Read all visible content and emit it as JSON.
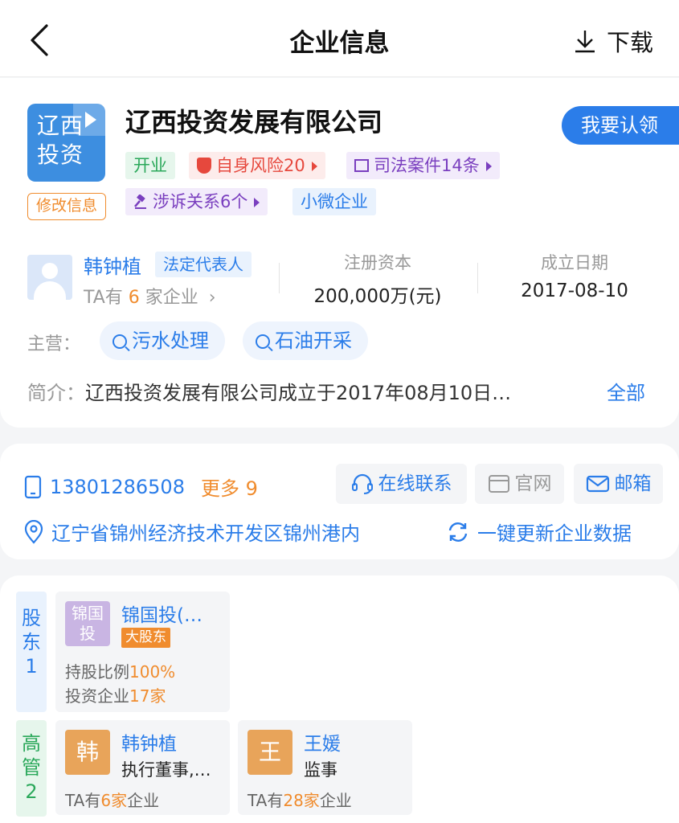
{
  "header": {
    "title": "企业信息",
    "download_label": "下载"
  },
  "company": {
    "logo_line1": "辽西",
    "logo_line2": "投资",
    "name": "辽西投资发展有限公司",
    "claim_label": "我要认领",
    "edit_label": "修改信息",
    "tags": {
      "status": "开业",
      "risk": "自身风险20",
      "judicial": "司法案件14条",
      "litigation": "涉诉关系6个",
      "size": "小微企业"
    },
    "legal_rep": {
      "name": "韩钟植",
      "role": "法定代表人",
      "sub_prefix": "TA有",
      "sub_count": "6",
      "sub_suffix": "家企业"
    },
    "registered_capital": {
      "label": "注册资本",
      "value": "200,000万(元)"
    },
    "established": {
      "label": "成立日期",
      "value": "2017-08-10"
    },
    "business_label": "主营：",
    "business_items": [
      "污水处理",
      "石油开采"
    ],
    "intro_label": "简介：",
    "intro_text": "辽西投资发展有限公司成立于2017年08月10日…",
    "intro_all": "全部"
  },
  "contact": {
    "phone": "13801286508",
    "phone_more": "更多 9",
    "online_label": "在线联系",
    "website_label": "官网",
    "email_label": "邮箱",
    "address": "辽宁省锦州经济技术开发区锦州港内",
    "refresh_label": "一键更新企业数据"
  },
  "shareholders": {
    "side_label": [
      "股",
      "东",
      "1"
    ],
    "items": [
      {
        "logo_line1": "锦国",
        "logo_line2": "投",
        "name": "锦国投(…",
        "badge": "大股东",
        "ratio_label": "持股比例",
        "ratio_value": "100%",
        "invest_label": "投资企业",
        "invest_value": "17家"
      }
    ]
  },
  "executives": {
    "side_label": [
      "高",
      "管",
      "2"
    ],
    "items": [
      {
        "initial": "韩",
        "name": "韩钟植",
        "role": "执行董事,…",
        "foot_prefix": "TA有",
        "foot_count": "6家",
        "foot_suffix": "企业"
      },
      {
        "initial": "王",
        "name": "王媛",
        "role": "监事",
        "foot_prefix": "TA有",
        "foot_count": "28家",
        "foot_suffix": "企业"
      }
    ]
  },
  "colors": {
    "accent": "#2b7de9",
    "orange": "#f08c2e",
    "green": "#2aa85a",
    "red": "#e6483d",
    "purple": "#7a3fbf"
  },
  "icons": [
    "back-arrow-icon",
    "download-icon",
    "play-icon",
    "shield-icon",
    "book-icon",
    "gavel-icon",
    "search-icon",
    "phone-icon",
    "headset-icon",
    "browser-icon",
    "mail-icon",
    "location-icon",
    "refresh-icon"
  ]
}
